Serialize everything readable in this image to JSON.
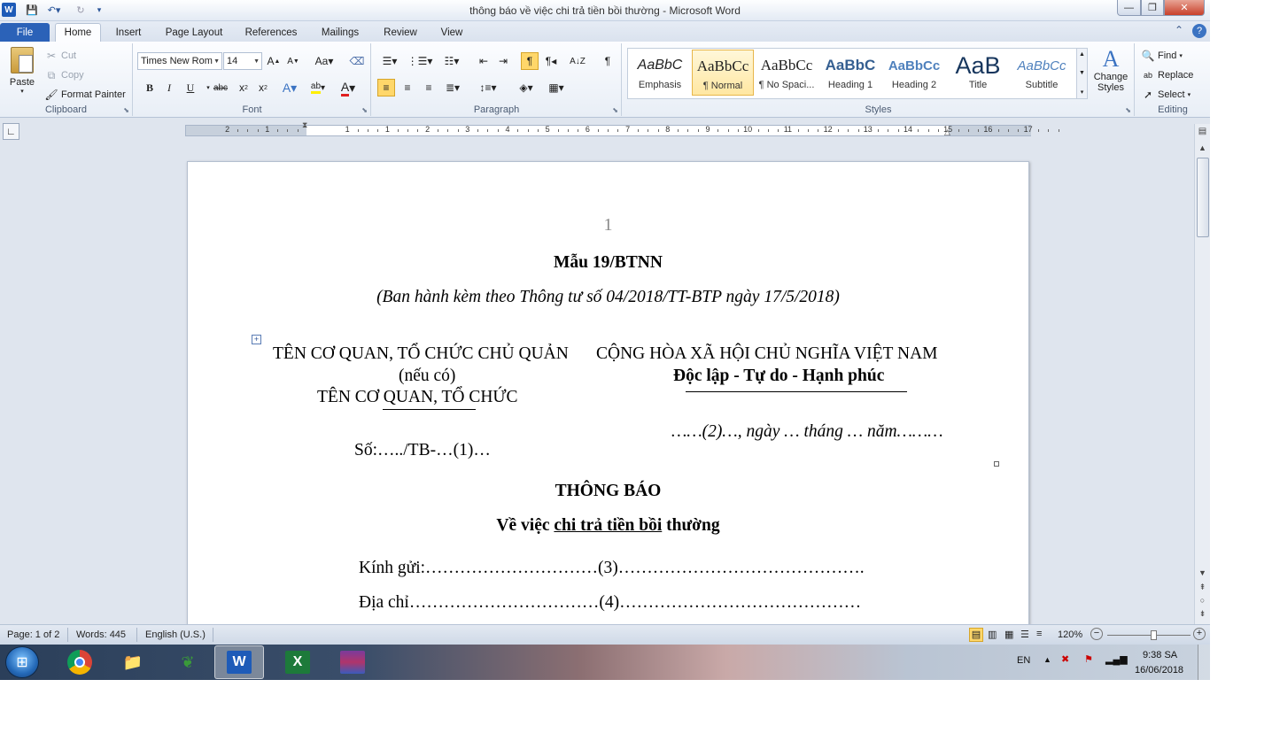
{
  "window": {
    "title": "thông báo về việc chi trả tiền bồi thường  -  Microsoft Word",
    "app_icon": "W",
    "minimize": "—",
    "maximize": "❐",
    "close": "✕"
  },
  "tabs": [
    "File",
    "Home",
    "Insert",
    "Page Layout",
    "References",
    "Mailings",
    "Review",
    "View"
  ],
  "clipboard": {
    "paste": "Paste",
    "cut": "Cut",
    "copy": "Copy",
    "format_painter": "Format Painter",
    "group_label": "Clipboard"
  },
  "font": {
    "name": "Times New Rom",
    "size": "14",
    "group_label": "Font"
  },
  "paragraph": {
    "group_label": "Paragraph"
  },
  "styles": {
    "items": [
      {
        "preview": "AaBbC",
        "name": "Emphasis"
      },
      {
        "preview": "AaBbCc",
        "name": "¶ Normal"
      },
      {
        "preview": "AaBbCc",
        "name": "¶ No Spaci..."
      },
      {
        "preview": "AaBbC",
        "name": "Heading 1"
      },
      {
        "preview": "AaBbCc",
        "name": "Heading 2"
      },
      {
        "preview": "AaB",
        "name": "Title"
      },
      {
        "preview": "AaBbCc",
        "name": "Subtitle"
      }
    ],
    "change_styles": "Change Styles",
    "group_label": "Styles"
  },
  "editing": {
    "find": "Find",
    "replace": "Replace",
    "select": "Select",
    "group_label": "Editing"
  },
  "ruler": {
    "numbers": [
      "2",
      "1",
      "1",
      "1",
      "2",
      "3",
      "4",
      "5",
      "6",
      "7",
      "8",
      "9",
      "10",
      "11",
      "12",
      "13",
      "14",
      "15",
      "16",
      "17"
    ]
  },
  "document": {
    "page_number": "1",
    "form_code": "Mẫu 19/BTNN",
    "issued_by": "(Ban hành kèm theo Thông tư số 04/2018/TT-BTP  ngày 17/5/2018)",
    "agency_parent": "TÊN CƠ QUAN, TỔ CHỨC CHỦ QUẢN",
    "agency_parent_note": "(nếu có)",
    "agency": "TÊN CƠ QUAN, TỔ CHỨC",
    "country": "CỘNG HÒA XÃ HỘI CHỦ NGHĨA VIỆT NAM",
    "motto": "Độc lập - Tự do - Hạnh phúc",
    "date_line": "……(2)…, ngày … tháng … năm………",
    "number_line": "Số:…../TB-…(1)…",
    "doc_title": "THÔNG BÁO",
    "subject_prefix": "Về việc ",
    "subject_underlined": "chi trả tiền bồi",
    "subject_suffix": " thường",
    "to_line": "Kính gửi:…………………………(3)…………………………………….",
    "address_line": "Địa chỉ……………………………(4)……………………………………"
  },
  "status": {
    "page": "Page: 1 of 2",
    "words": "Words: 445",
    "language": "English (U.S.)",
    "zoom": "120%",
    "zoom_fraction": 0.55
  },
  "taskbar": {
    "lang": "EN",
    "time": "9:38 SA",
    "date": "16/06/2018"
  }
}
